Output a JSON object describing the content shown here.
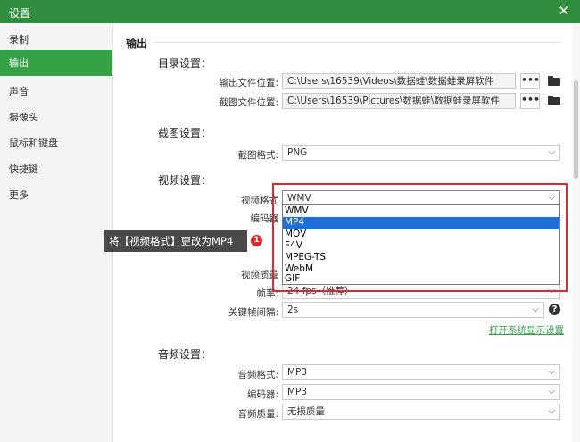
{
  "window": {
    "title": "设置",
    "close": "✕"
  },
  "sidebar": {
    "items": [
      {
        "label": "录制"
      },
      {
        "label": "输出"
      },
      {
        "label": "声音"
      },
      {
        "label": "摄像头"
      },
      {
        "label": "鼠标和键盘"
      },
      {
        "label": "快捷键"
      },
      {
        "label": "更多"
      }
    ],
    "active": "输出"
  },
  "section": {
    "title": "输出"
  },
  "directory": {
    "heading": "目录设置：",
    "output_label": "输出文件位置:",
    "output_value": "C:\\Users\\16539\\Videos\\数据蛙\\数据蛙录屏软件",
    "screenshot_label": "截图文件位置:",
    "screenshot_value": "C:\\Users\\16539\\Pictures\\数据蛙\\数据蛙录屏软件",
    "browse": "•••"
  },
  "screenshot": {
    "heading": "截图设置：",
    "format_label": "截图格式:",
    "format_value": "PNG"
  },
  "video": {
    "heading": "视频设置：",
    "format_label": "视频格式",
    "format_value": "WMV",
    "encoder_label": "编码器",
    "quality_label": "视频质量",
    "fps_label": "帧率:",
    "fps_value": "24 fps（推荐）",
    "keyframe_label": "关键帧间隔:",
    "keyframe_value": "2s",
    "help": "?",
    "open_display_settings": "打开系统显示设置",
    "format_options": [
      "WMV",
      "MP4",
      "MOV",
      "F4V",
      "MPEG-TS",
      "WebM",
      "GIF"
    ],
    "format_selected": "MP4"
  },
  "audio": {
    "heading": "音频设置：",
    "format_label": "音频格式:",
    "format_value": "MP3",
    "encoder_label": "编码器:",
    "encoder_value": "MP3",
    "quality_label": "音频质量:",
    "quality_value": "无损质量"
  },
  "annotation": {
    "tooltip": "将【视频格式】更改为MP4",
    "step": "1"
  },
  "icons": {
    "chevron": "⌵"
  },
  "colors": {
    "accent": "#36a145",
    "titlebar": "#2f8f3f",
    "highlight": "#e2262e",
    "selection": "#1e6fd9"
  }
}
